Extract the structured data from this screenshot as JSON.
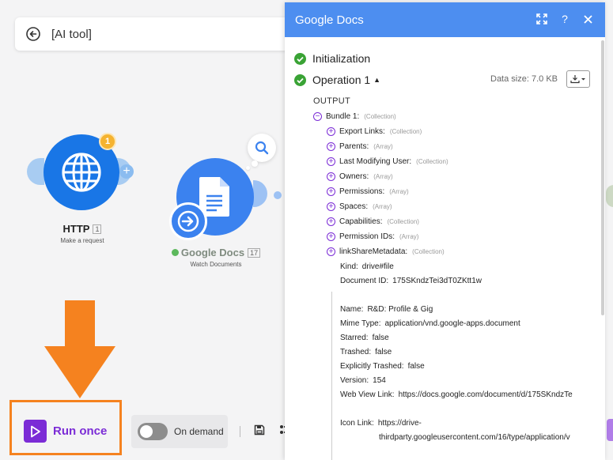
{
  "scenario": {
    "name": "[AI tool]"
  },
  "modules": {
    "http": {
      "title": "HTTP",
      "number": "1",
      "subtitle": "Make a request",
      "badge": "1"
    },
    "gdocs": {
      "title": "Google Docs",
      "number": "17",
      "subtitle": "Watch Documents"
    }
  },
  "toolbar": {
    "run_once_label": "Run once",
    "schedule_label": "On demand"
  },
  "panel": {
    "title": "Google Docs",
    "steps": [
      {
        "label": "Initialization"
      },
      {
        "label": "Operation 1"
      }
    ],
    "data_size": "Data size: 7.0 KB",
    "output_label": "OUTPUT",
    "bundle": {
      "key": "Bundle 1:",
      "type": "(Collection)"
    },
    "collapsed_items": [
      {
        "key": "Export Links:",
        "type": "(Collection)"
      },
      {
        "key": "Parents:",
        "type": "(Array)"
      },
      {
        "key": "Last Modifying User:",
        "type": "(Collection)"
      },
      {
        "key": "Owners:",
        "type": "(Array)"
      },
      {
        "key": "Permissions:",
        "type": "(Array)"
      },
      {
        "key": "Spaces:",
        "type": "(Array)"
      },
      {
        "key": "Capabilities:",
        "type": "(Collection)"
      },
      {
        "key": "Permission IDs:",
        "type": "(Array)"
      },
      {
        "key": "linkShareMetadata:",
        "type": "(Collection)"
      }
    ],
    "fields": [
      {
        "key": "Kind:",
        "value": "drive#file"
      },
      {
        "key": "Document ID:",
        "value": "175SKndzTei3dT0ZKtt1w"
      },
      {
        "key": "Name:",
        "value": "R&D: Profile & Gig"
      },
      {
        "key": "Mime Type:",
        "value": "application/vnd.google-apps.document"
      },
      {
        "key": "Starred:",
        "value": "false"
      },
      {
        "key": "Trashed:",
        "value": "false"
      },
      {
        "key": "Explicitly Trashed:",
        "value": "false"
      },
      {
        "key": "Version:",
        "value": "154"
      },
      {
        "key": "Web View Link:",
        "value": "https://docs.google.com/document/d/175SKndzTe"
      },
      {
        "key": "Icon Link:",
        "value": "https://drive-",
        "value2": "thirdparty.googleusercontent.com/16/type/application/v"
      }
    ]
  },
  "colors": {
    "panel_header": "#4d8ef0",
    "run_purple": "#7b2cd6",
    "highlight_orange": "#f5821f",
    "http_blue": "#1976e6",
    "success_green": "#3aa335"
  }
}
